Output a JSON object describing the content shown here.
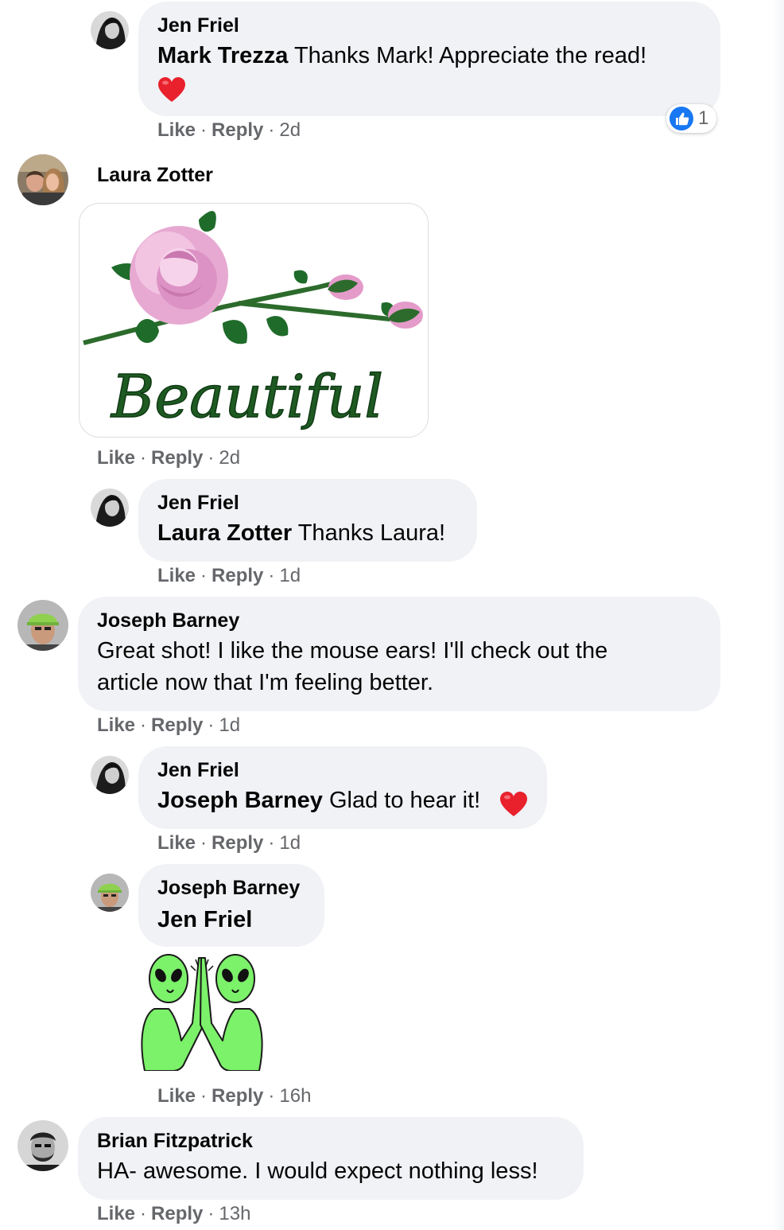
{
  "colors": {
    "bubble": "#f0f2f5",
    "meta_text": "#65676b",
    "like_blue": "#1877f2",
    "heart_red": "#f33e58"
  },
  "comments": [
    {
      "author": "Jen Friel",
      "mention": "Mark Trezza",
      "text": " Thanks Mark! Appreciate the read!",
      "emoji": "red-heart",
      "like": "Like",
      "reply": "Reply",
      "time": "2d",
      "reaction_count": "1",
      "reaction_icon": "thumbs-up-icon"
    },
    {
      "author": "Laura Zotter",
      "sticker_text": "Beautiful",
      "like": "Like",
      "reply": "Reply",
      "time": "2d"
    },
    {
      "author": "Jen Friel",
      "mention": "Laura Zotter",
      "text": " Thanks Laura!",
      "like": "Like",
      "reply": "Reply",
      "time": "1d"
    },
    {
      "author": "Joseph Barney",
      "line1": "Great shot! I like the mouse ears! I'll check out the",
      "line2": "article now that I'm feeling better.",
      "like": "Like",
      "reply": "Reply",
      "time": "1d"
    },
    {
      "author": "Jen Friel",
      "mention": "Joseph Barney",
      "text": " Glad to hear it!",
      "emoji": "red-heart",
      "like": "Like",
      "reply": "Reply",
      "time": "1d"
    },
    {
      "author": "Joseph Barney",
      "mention": "Jen Friel",
      "sticker": "aliens-high-five",
      "like": "Like",
      "reply": "Reply",
      "time": "16h"
    },
    {
      "author": "Brian Fitzpatrick",
      "text": "HA- awesome. I would expect nothing less!",
      "like": "Like",
      "reply": "Reply",
      "time": "13h"
    }
  ],
  "separator": "·"
}
